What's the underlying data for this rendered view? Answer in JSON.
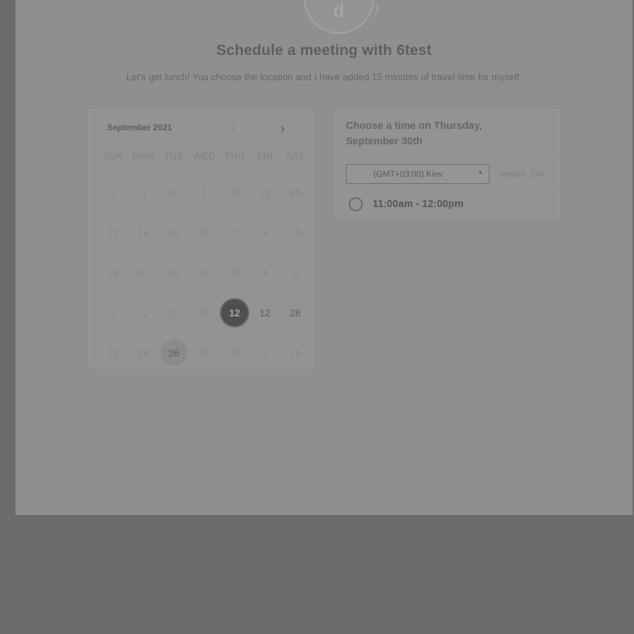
{
  "header": {
    "avatar_letter": "d",
    "title": "Schedule a meeting with 6test",
    "subtitle": "Let's get lunch! You choose the location and I have added 15 minutes of travel time for myself."
  },
  "calendar": {
    "month_label": "September 2021",
    "prev_icon": "‹",
    "next_icon": "›",
    "weekdays": [
      "SUN",
      "MON",
      "TUE",
      "WED",
      "THU",
      "FRI",
      "SAT"
    ],
    "days": [
      [
        "1",
        "4",
        "16",
        "1",
        "22",
        "12",
        "25"
      ],
      [
        "21",
        "14",
        "16",
        "23",
        "2",
        "3",
        "10"
      ],
      [
        "23",
        "31",
        "18",
        "13",
        "29",
        "4",
        "6"
      ],
      [
        "3",
        "11",
        "27",
        "16",
        "12",
        "12",
        "28"
      ],
      [
        "21",
        "28",
        "26",
        "23",
        "27",
        "2",
        "15"
      ]
    ],
    "available": [
      [
        3,
        5
      ],
      [
        3,
        6
      ]
    ],
    "today": [
      4,
      2
    ],
    "selected": [
      3,
      4
    ]
  },
  "times": {
    "title": "Choose a time on Thursday, September 30th",
    "timezone": "(GMT+03:00) Kiev",
    "caret_icon": "▾",
    "format_ampm": "am/pm",
    "format_24h": "24h",
    "slots": [
      "11:00am - 12:00pm"
    ]
  },
  "colors": {
    "overlay_background": "#6b6b6b",
    "panel_background": "#8f8f8f",
    "selected_day": "#4f4f4f"
  }
}
